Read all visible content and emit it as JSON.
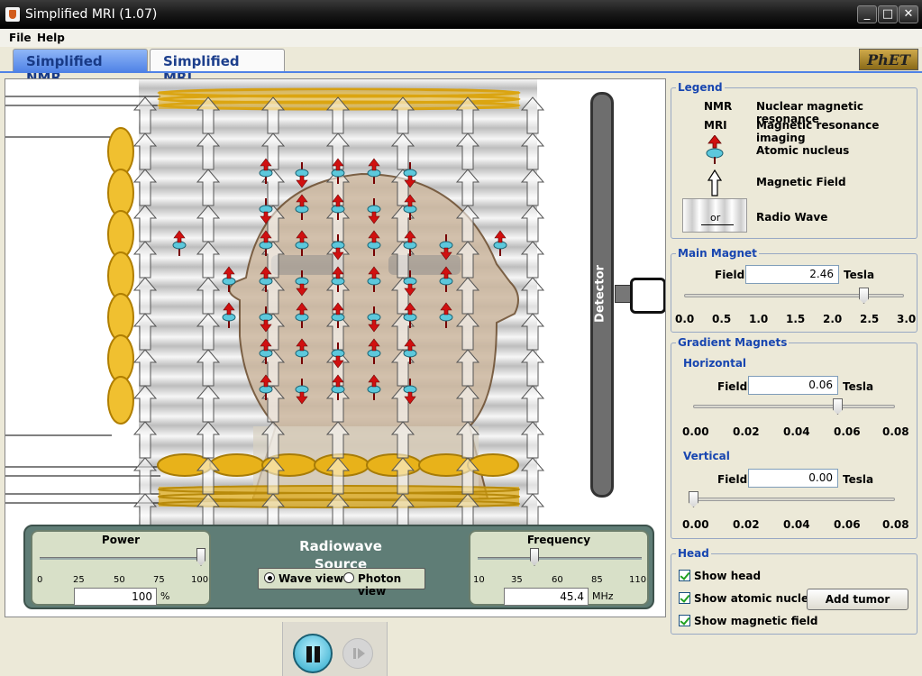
{
  "window": {
    "title": "Simplified MRI (1.07)"
  },
  "menu": [
    "File",
    "Help"
  ],
  "tabs": [
    {
      "label": "Simplified NMR",
      "active": false
    },
    {
      "label": "Simplified MRI",
      "active": true
    }
  ],
  "brand": "PhET",
  "detector": {
    "label": "Detector"
  },
  "radiowave": {
    "title": "Radiowave Source",
    "title_line1": "Radiowave",
    "title_line2": "Source",
    "power": {
      "title": "Power",
      "ticks": [
        "0",
        "25",
        "50",
        "75",
        "100"
      ],
      "value": "100",
      "unit": "%",
      "level_percent": 100
    },
    "frequency": {
      "title": "Frequency",
      "ticks": [
        "10",
        "35",
        "60",
        "85",
        "110"
      ],
      "value": "45.4",
      "unit": "MHz"
    },
    "view_options": [
      {
        "label": "Wave view",
        "selected": true
      },
      {
        "label": "Photon view",
        "selected": false
      }
    ]
  },
  "legend": {
    "title": "Legend",
    "items": [
      {
        "key": "NMR",
        "desc": "Nuclear magnetic resonance"
      },
      {
        "key": "MRI",
        "desc": "Magnetic resonance imaging"
      },
      {
        "icon": "atomic-nucleus-icon",
        "desc": "Atomic nucleus"
      },
      {
        "icon": "magnetic-field-arrow-icon",
        "desc": "Magnetic Field"
      },
      {
        "icon": "radio-wave-icon",
        "icon_text": "or",
        "desc": "Radio Wave"
      }
    ]
  },
  "main_magnet": {
    "title": "Main Magnet",
    "field_label": "Field:",
    "value": "2.46",
    "unit": "Tesla",
    "ticks": [
      "0.0",
      "0.5",
      "1.0",
      "1.5",
      "2.0",
      "2.5",
      "3.0"
    ]
  },
  "gradient": {
    "title": "Gradient Magnets",
    "horizontal": {
      "title": "Horizontal",
      "field_label": "Field:",
      "value": "0.06",
      "unit": "Tesla",
      "ticks": [
        "0.00",
        "0.02",
        "0.04",
        "0.06",
        "0.08"
      ]
    },
    "vertical": {
      "title": "Vertical",
      "field_label": "Field:",
      "value": "0.00",
      "unit": "Tesla",
      "ticks": [
        "0.00",
        "0.02",
        "0.04",
        "0.06",
        "0.08"
      ]
    }
  },
  "head": {
    "title": "Head",
    "options": [
      {
        "label": "Show head",
        "checked": true
      },
      {
        "label": "Show atomic nuclei",
        "checked": true
      },
      {
        "label": "Show magnetic field",
        "checked": true
      }
    ],
    "add_tumor": "Add tumor"
  },
  "colors": {
    "magnet_gold": "#e0aa10",
    "nucleus_cyan": "#5cc8dc",
    "nucleus_arrow_red": "#d01010",
    "accent_blue": "#1846b0"
  }
}
